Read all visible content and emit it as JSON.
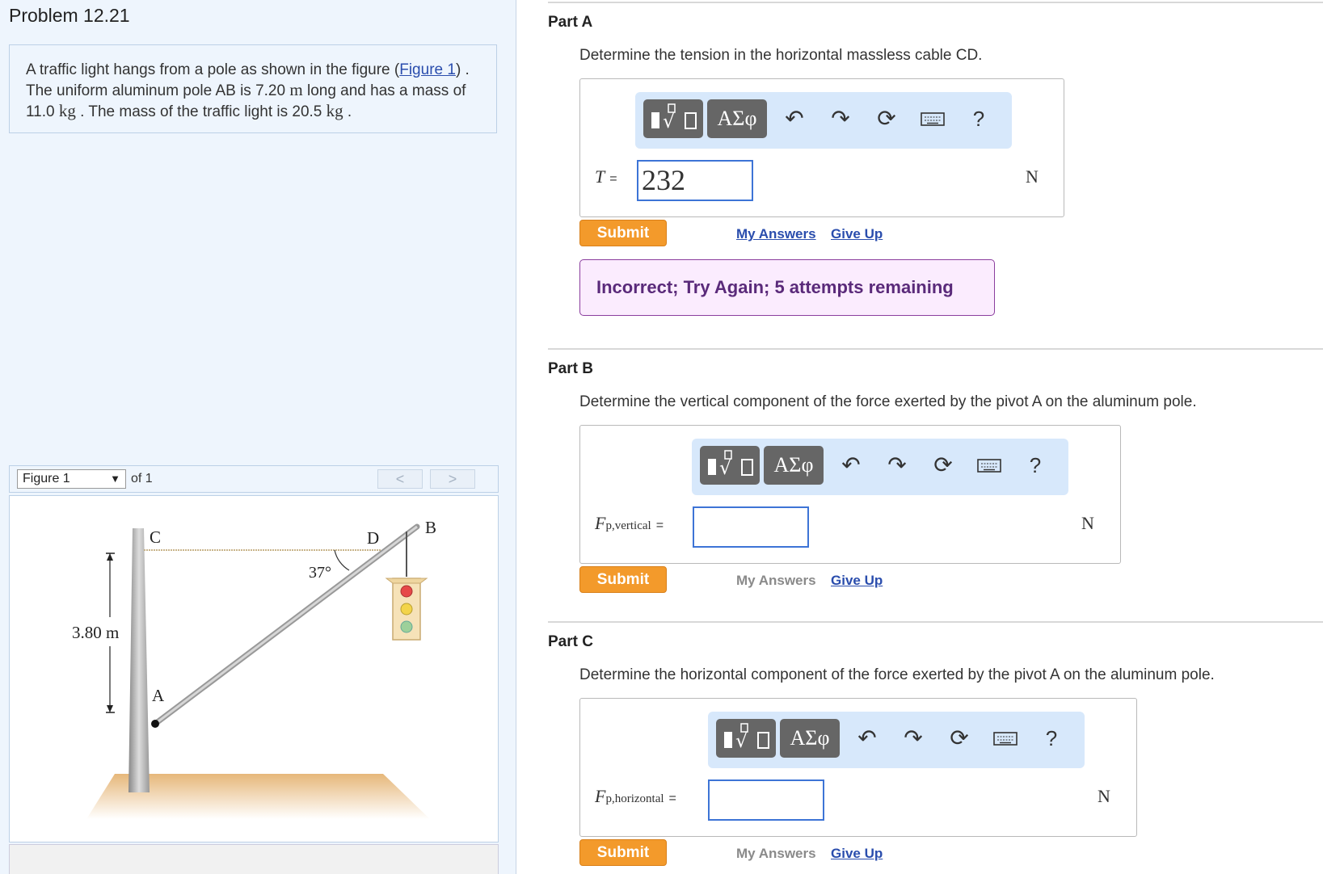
{
  "problem": {
    "title": "Problem 12.21",
    "text_1": "A traffic light hangs from a pole as shown in the figure (",
    "figure_link": "Figure 1",
    "text_2": ") .",
    "text_3": "The uniform aluminum pole AB is 7.20 ",
    "length_unit": "m",
    "text_4": " long and has a mass of",
    "text_5": "11.0 ",
    "mass_unit_1": "kg",
    "text_6": " . The mass of the traffic light is 20.5 ",
    "mass_unit_2": "kg",
    "text_7": " ."
  },
  "figure_nav": {
    "selected": "Figure 1",
    "of_label": "of 1",
    "prev": "<",
    "next": ">"
  },
  "figure": {
    "label_c": "C",
    "label_d": "D",
    "label_b": "B",
    "label_a": "A",
    "angle": "37°",
    "height": "3.80 m"
  },
  "toolbar": {
    "greek": "ΑΣφ",
    "help": "?",
    "icons": [
      "templates-icon",
      "greek-letters-icon",
      "undo-icon",
      "redo-icon",
      "reset-icon",
      "keyboard-icon",
      "help-icon"
    ]
  },
  "parts": [
    {
      "title": "Part A",
      "question": "Determine the tension in the horizontal massless cable CD.",
      "var": "T",
      "sub": "",
      "eq": "=",
      "value": "232",
      "unit": "N",
      "submit": "Submit",
      "my_answers": "My Answers",
      "give_up": "Give Up",
      "feedback": "Incorrect; Try Again; 5 attempts remaining"
    },
    {
      "title": "Part B",
      "question": "Determine the vertical component of the force exerted by the pivot A on the aluminum pole.",
      "var": "F",
      "sub": "p,vertical",
      "eq": "=",
      "value": "",
      "unit": "N",
      "submit": "Submit",
      "my_answers": "My Answers",
      "give_up": "Give Up"
    },
    {
      "title": "Part C",
      "question": "Determine the horizontal component of the force exerted by the pivot A on the aluminum pole.",
      "var": "F",
      "sub": "p,horizontal",
      "eq": "=",
      "value": "",
      "unit": "N",
      "submit": "Submit",
      "my_answers": "My Answers",
      "give_up": "Give Up"
    }
  ],
  "colors": {
    "accent_orange": "#f39a2b",
    "link_blue": "#2a4dad",
    "toolbar_bg": "#d7e8fb",
    "feedback_border": "#8b3e9e"
  }
}
